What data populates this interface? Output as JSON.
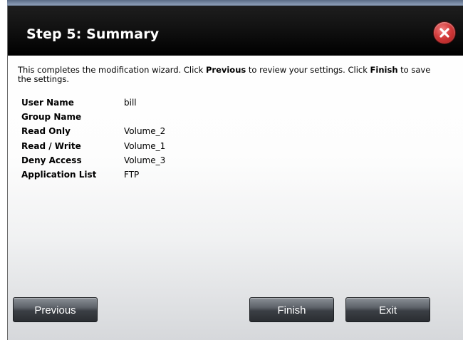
{
  "dialog": {
    "title": "Step 5: Summary",
    "close_icon": "close-icon"
  },
  "intro": {
    "part1": "This completes the modification wizard. Click ",
    "previous_word": "Previous",
    "part2": " to review your settings. Click ",
    "finish_word": "Finish",
    "part3": " to save the settings."
  },
  "summary": {
    "rows": [
      {
        "label": "User Name",
        "value": "bill"
      },
      {
        "label": "Group Name",
        "value": ""
      },
      {
        "label": "Read Only",
        "value": "Volume_2"
      },
      {
        "label": "Read / Write",
        "value": "Volume_1"
      },
      {
        "label": "Deny Access",
        "value": "Volume_3"
      },
      {
        "label": "Application List",
        "value": "FTP"
      }
    ]
  },
  "buttons": {
    "previous": "Previous",
    "finish": "Finish",
    "exit": "Exit"
  },
  "colors": {
    "title_bar": "#000000",
    "close_button": "#d23a3a",
    "button_dark": "#3b3f45"
  }
}
